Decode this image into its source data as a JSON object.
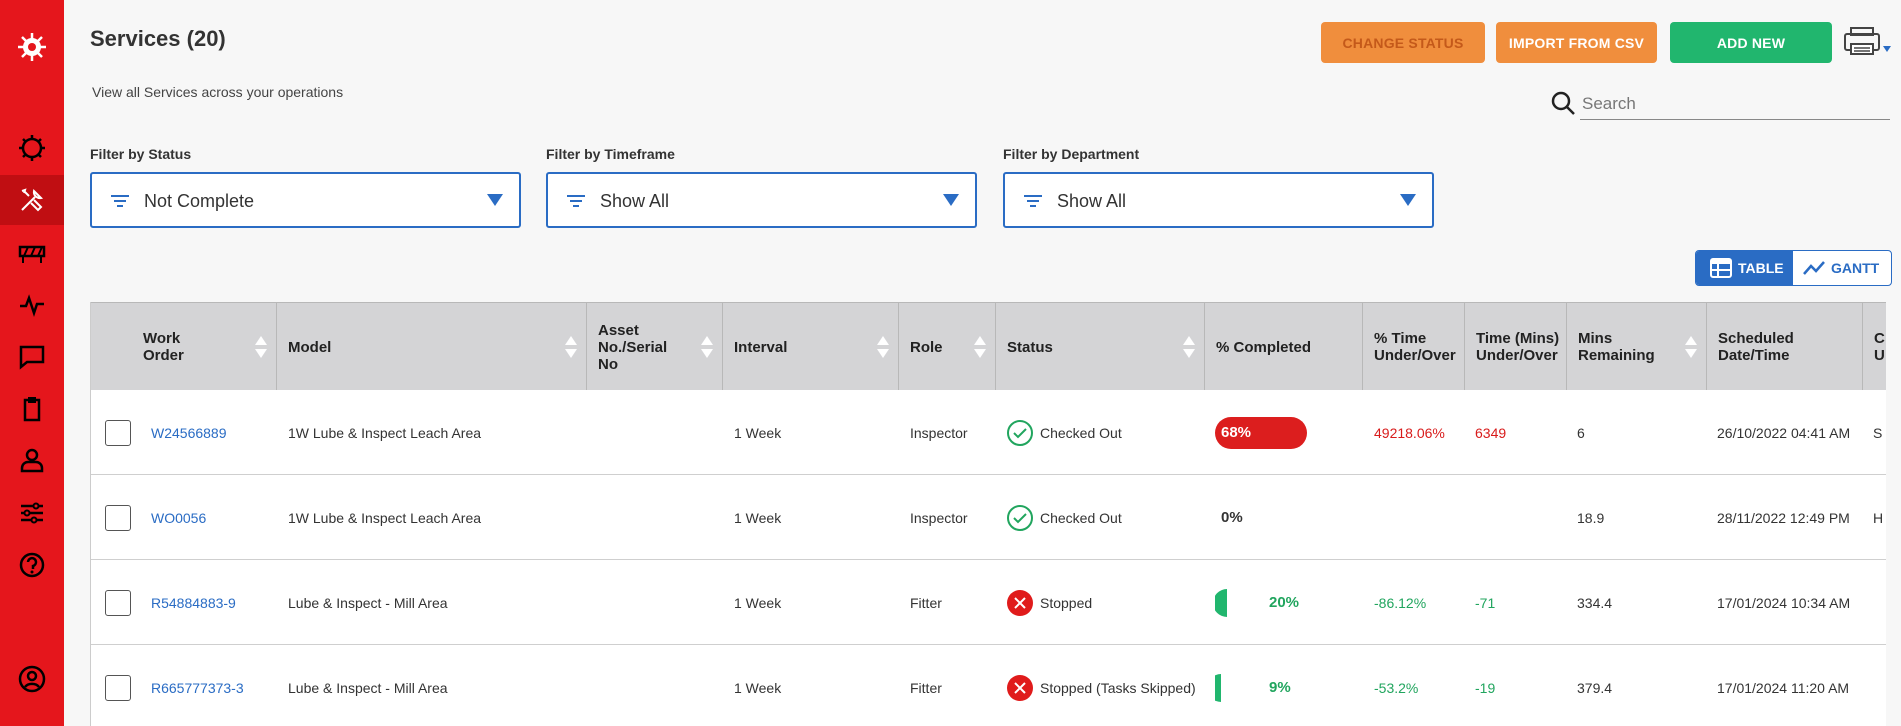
{
  "page": {
    "title": "Services (20)",
    "subtitle": "View all Services across your operations"
  },
  "toolbar": {
    "change_status": "CHANGE STATUS",
    "import_csv": "IMPORT FROM CSV",
    "add_new": "ADD NEW"
  },
  "search": {
    "placeholder": "Search"
  },
  "filters": {
    "status": {
      "label": "Filter by Status",
      "value": "Not Complete"
    },
    "timeframe": {
      "label": "Filter by Timeframe",
      "value": "Show All"
    },
    "department": {
      "label": "Filter by Department",
      "value": "Show All"
    }
  },
  "view_toggle": {
    "table": "TABLE",
    "gantt": "GANTT"
  },
  "columns": {
    "work_order": "Work Order",
    "model": "Model",
    "asset": "Asset No./Serial No",
    "interval": "Interval",
    "role": "Role",
    "status": "Status",
    "pct_completed": "% Completed",
    "pct_time": "% Time Under/Over",
    "time_mins": "Time (Mins) Under/Over",
    "mins_remaining": "Mins Remaining",
    "scheduled": "Scheduled Date/Time",
    "next_col": "C U"
  },
  "rows": [
    {
      "work_order": "W24566889",
      "model": "1W Lube & Inspect Leach Area",
      "interval": "1 Week",
      "role": "Inspector",
      "status": "Checked Out",
      "pct_completed": "68%",
      "pct_time": "49218.06%",
      "time_mins": "6349",
      "mins_remaining": "6",
      "scheduled": "26/10/2022 04:41 AM",
      "next_col": "S"
    },
    {
      "work_order": "WO0056",
      "model": "1W Lube & Inspect Leach Area",
      "interval": "1 Week",
      "role": "Inspector",
      "status": "Checked Out",
      "pct_completed": "0%",
      "pct_time": "",
      "time_mins": "",
      "mins_remaining": "18.9",
      "scheduled": "28/11/2022 12:49 PM",
      "next_col": "H"
    },
    {
      "work_order": "R54884883-9",
      "model": "Lube & Inspect - Mill Area",
      "interval": "1 Week",
      "role": "Fitter",
      "status": "Stopped",
      "pct_completed": "20%",
      "pct_time": "-86.12%",
      "time_mins": "-71",
      "mins_remaining": "334.4",
      "scheduled": "17/01/2024 10:34 AM",
      "next_col": ""
    },
    {
      "work_order": "R665777373-3",
      "model": "Lube & Inspect - Mill Area",
      "interval": "1 Week",
      "role": "Fitter",
      "status": "Stopped (Tasks Skipped)",
      "pct_completed": "9%",
      "pct_time": "-53.2%",
      "time_mins": "-19",
      "mins_remaining": "379.4",
      "scheduled": "17/01/2024 11:20 AM",
      "next_col": ""
    }
  ],
  "progress_fractions": [
    0.68,
    0.0,
    0.2,
    0.09
  ],
  "colors": {
    "brand_red": "#e5161c",
    "accent_blue": "#2a6cc4",
    "orange": "#f08e3d",
    "green": "#21b66e"
  },
  "sidebar_icons": [
    "logo-icon",
    "dashboard-icon",
    "services-icon",
    "equipment-icon",
    "activity-icon",
    "messages-icon",
    "documents-icon",
    "user-icon",
    "settings-icon",
    "help-icon",
    "account-icon"
  ]
}
